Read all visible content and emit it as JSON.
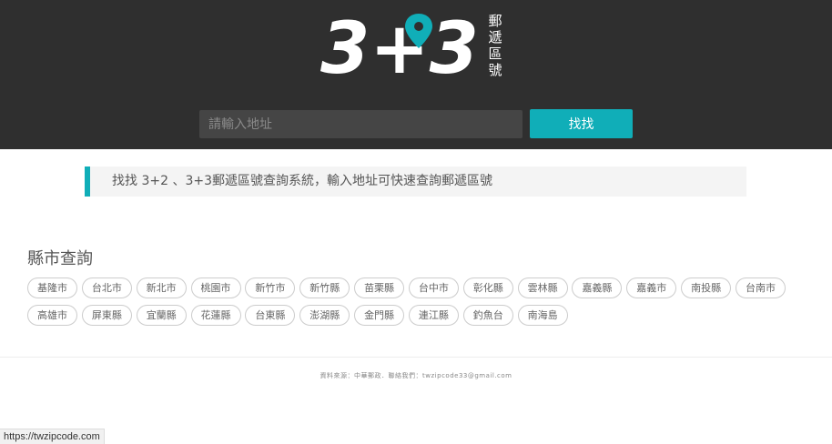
{
  "header": {
    "logo": {
      "main_text": "3+3",
      "side_text": [
        "郵",
        "遞",
        "區",
        "號"
      ],
      "accent_color": "#10aeb8"
    },
    "search": {
      "placeholder": "請輸入地址",
      "value": "",
      "button_label": "找找"
    }
  },
  "intro": {
    "text": "找找 3+2 、3+3郵遞區號查詢系統，輸入地址可快速查詢郵遞區號"
  },
  "county_section": {
    "title": "縣市查詢",
    "counties": [
      "基隆市",
      "台北市",
      "新北市",
      "桃園市",
      "新竹市",
      "新竹縣",
      "苗栗縣",
      "台中市",
      "彰化縣",
      "雲林縣",
      "嘉義縣",
      "嘉義市",
      "南投縣",
      "台南市",
      "高雄市",
      "屏東縣",
      "宜蘭縣",
      "花蓮縣",
      "台東縣",
      "澎湖縣",
      "金門縣",
      "連江縣",
      "釣魚台",
      "南海島"
    ]
  },
  "footer": {
    "text": "資料來源：中華郵政．聯絡我們：twzipcode33@gmail.com"
  },
  "status_bar": {
    "url": "https://twzipcode.com"
  },
  "colors": {
    "header_bg": "#2f2f2f",
    "accent": "#10aeb8"
  }
}
